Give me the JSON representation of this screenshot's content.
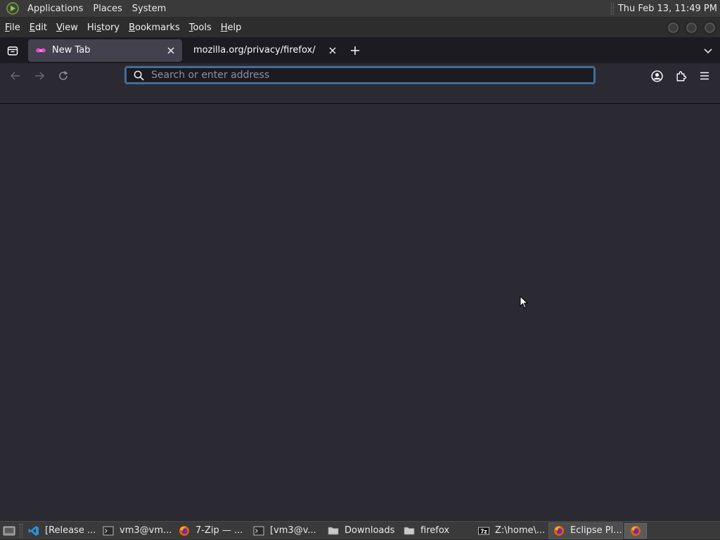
{
  "system_panel": {
    "menus": [
      "Applications",
      "Places",
      "System"
    ],
    "clock": "Thu Feb 13, 11:49 PM"
  },
  "menubar": {
    "items": [
      {
        "label": "File",
        "mnemonic": "F",
        "rest": "ile"
      },
      {
        "label": "Edit",
        "mnemonic": "E",
        "rest": "dit"
      },
      {
        "label": "View",
        "mnemonic": "V",
        "rest": "iew"
      },
      {
        "label": "History",
        "mnemonic": "",
        "pre": "Hi",
        "mn": "s",
        "rest": "tory"
      },
      {
        "label": "Bookmarks",
        "mnemonic": "B",
        "rest": "ookmarks"
      },
      {
        "label": "Tools",
        "mnemonic": "T",
        "rest": "ools"
      },
      {
        "label": "Help",
        "mnemonic": "H",
        "rest": "elp"
      }
    ]
  },
  "tabs": [
    {
      "label": "New Tab",
      "active": true,
      "favicon": "firefox-newtab-icon"
    },
    {
      "label": "mozilla.org/privacy/firefox/",
      "active": false,
      "favicon": "none"
    }
  ],
  "urlbar": {
    "placeholder": "Search or enter address",
    "value": ""
  },
  "taskbar": {
    "items": [
      {
        "label": "[Release ...",
        "icon": "vscode-icon",
        "active": false
      },
      {
        "label": "vm3@vm...",
        "icon": "terminal-icon",
        "active": false
      },
      {
        "label": "7-Zip — ...",
        "icon": "firefox-icon",
        "active": false
      },
      {
        "label": "[vm3@v...",
        "icon": "terminal-icon",
        "active": false
      },
      {
        "label": "Downloads",
        "icon": "folder-icon",
        "active": false
      },
      {
        "label": "firefox",
        "icon": "folder-icon",
        "active": false
      },
      {
        "label": "Z:\\home\\...",
        "icon": "7zip-icon",
        "active": false
      },
      {
        "label": "Eclipse Pl...",
        "icon": "firefox-icon",
        "active": true
      }
    ]
  },
  "colors": {
    "accent": "#3b6fb0",
    "background": "#2b2a33",
    "tabstrip": "#1c1b22",
    "active_tab": "#42414d"
  }
}
